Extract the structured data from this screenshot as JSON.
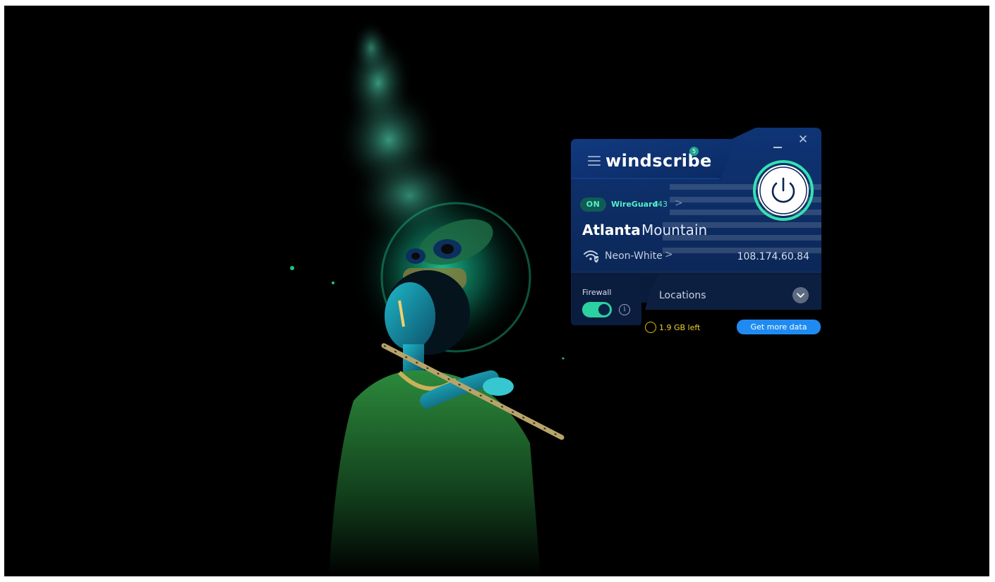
{
  "app": {
    "name": "windscribe",
    "notification_count": "5"
  },
  "connection": {
    "status": "ON",
    "protocol": "WireGuard",
    "port": "443",
    "city": "Atlanta",
    "nickname": "Mountain",
    "network_name": "Neon-White",
    "ip_address": "108.174.60.84"
  },
  "firewall": {
    "label": "Firewall",
    "enabled": true
  },
  "locations": {
    "label": "Locations"
  },
  "data_plan": {
    "remaining": "1.9 GB left",
    "cta_label": "Get more data"
  },
  "icons": {
    "menu": "hamburger-icon",
    "minimize": "minimize-icon",
    "close": "close-icon",
    "power": "power-icon",
    "wifi": "wifi-shield-icon",
    "info": "info-icon",
    "chevron": "chevron-down-icon"
  },
  "colors": {
    "accent_green": "#55f0c6",
    "toggle_on": "#2bd1a0",
    "window_dark": "#0b1d3d",
    "cta_blue": "#1f8bf2",
    "data_yellow": "#f0cf2e"
  }
}
